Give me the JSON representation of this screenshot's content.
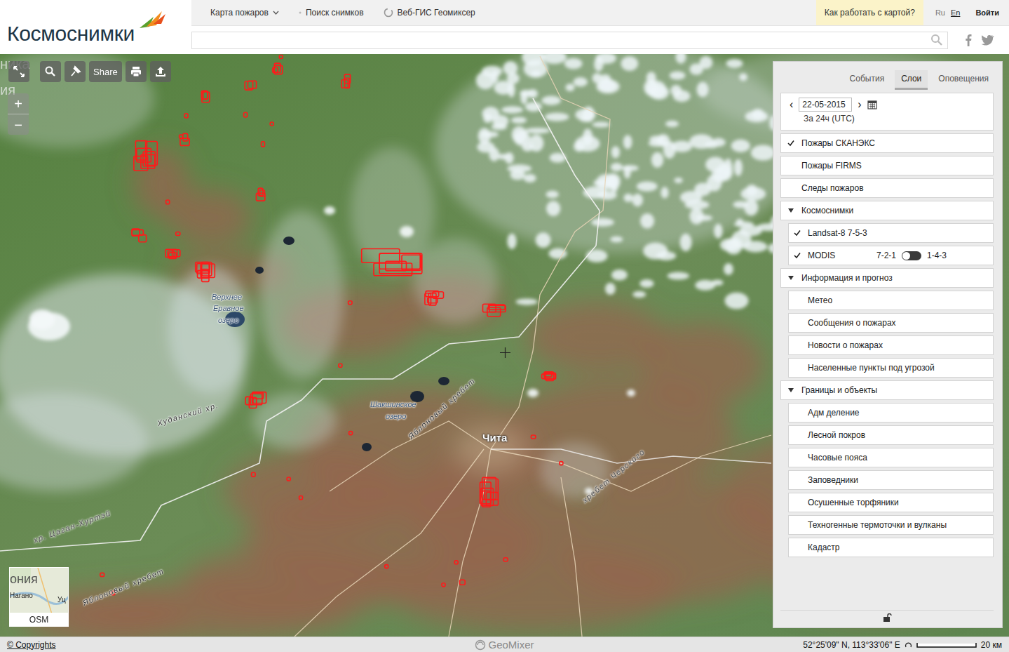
{
  "header": {
    "logo": "Космоснимки",
    "nav": [
      {
        "label": "Карта пожаров",
        "kind": "dropdown"
      },
      {
        "label": "Поиск снимков",
        "kind": "link"
      },
      {
        "label": "Веб-ГИС Геомиксер",
        "kind": "app"
      }
    ],
    "help": "Как работать с картой?",
    "languages": [
      {
        "label": "Ru",
        "selected": true
      },
      {
        "label": "En",
        "selected": false
      }
    ],
    "login": "Войти"
  },
  "search": {
    "placeholder": ""
  },
  "map": {
    "fragments": [
      "ника",
      "ия"
    ],
    "tools": {
      "share": "Share"
    },
    "zoom": {
      "in": "+",
      "out": "−"
    },
    "labels": [
      {
        "text": "Верхнее",
        "kind": "lake"
      },
      {
        "text": "Еравное",
        "kind": "lake"
      },
      {
        "text": "озеро",
        "kind": "lake"
      },
      {
        "text": "Шакшинское",
        "kind": "lake"
      },
      {
        "text": "озеро",
        "kind": "lake"
      },
      {
        "text": "Яблоновый хребет",
        "kind": "ridge"
      },
      {
        "text": "Худанский хр.",
        "kind": "ridge"
      },
      {
        "text": "Чита",
        "kind": "city"
      },
      {
        "text": "хребет Черского",
        "kind": "ridge"
      },
      {
        "text": "хр. Цаган-Хуртэй",
        "kind": "ridge"
      },
      {
        "text": "Яблоновый хребет",
        "kind": "ridge"
      }
    ]
  },
  "panel": {
    "tabs": [
      {
        "label": "События",
        "selected": false
      },
      {
        "label": "Слои",
        "selected": true
      },
      {
        "label": "Оповещения",
        "selected": false
      }
    ],
    "date": {
      "prev": "‹",
      "value": "22-05-2015",
      "next": "›",
      "period": "За 24ч (UTC)"
    },
    "layers": [
      {
        "label": "Пожары СКАНЭКС",
        "kind": "layer",
        "checked": true
      },
      {
        "label": "Пожары FIRMS",
        "kind": "layer",
        "checked": false
      },
      {
        "label": "Следы пожаров",
        "kind": "layer",
        "checked": false
      },
      {
        "label": "Космоснимки",
        "kind": "group",
        "expanded": true
      },
      {
        "label": "Landsat-8 7-5-3",
        "kind": "sublayer",
        "checked": true
      },
      {
        "label": "MODIS",
        "kind": "toggle",
        "checked": true,
        "option_left": "7-2-1",
        "option_right": "1-4-3",
        "toggle_on": false
      },
      {
        "label": "Информация и прогноз",
        "kind": "group",
        "expanded": true
      },
      {
        "label": "Метео",
        "kind": "sublayer",
        "checked": false
      },
      {
        "label": "Сообщения о пожарах",
        "kind": "sublayer",
        "checked": false
      },
      {
        "label": "Новости о пожарах",
        "kind": "sublayer",
        "checked": false
      },
      {
        "label": "Населенные пункты под угрозой",
        "kind": "sublayer",
        "checked": false
      },
      {
        "label": "Границы и объекты",
        "kind": "group",
        "expanded": true
      },
      {
        "label": "Адм деление",
        "kind": "sublayer",
        "checked": false
      },
      {
        "label": "Лесной покров",
        "kind": "sublayer",
        "checked": false
      },
      {
        "label": "Часовые пояса",
        "kind": "sublayer",
        "checked": false
      },
      {
        "label": "Заповедники",
        "kind": "sublayer",
        "checked": false
      },
      {
        "label": "Осушенные торфяники",
        "kind": "sublayer",
        "checked": false
      },
      {
        "label": "Техногенные термоточки и вулканы",
        "kind": "sublayer",
        "checked": false
      },
      {
        "label": "Кадастр",
        "kind": "sublayer",
        "checked": false
      }
    ]
  },
  "minimap": {
    "labels": [
      "ония",
      "Нагано",
      "Уц"
    ],
    "source": "OSM"
  },
  "status_bar": {
    "copyright": "© Copyrights",
    "brand": "GeoMixer",
    "coords": "52°25'09\" N, 113°33'06\" E",
    "scale": "20 км"
  }
}
